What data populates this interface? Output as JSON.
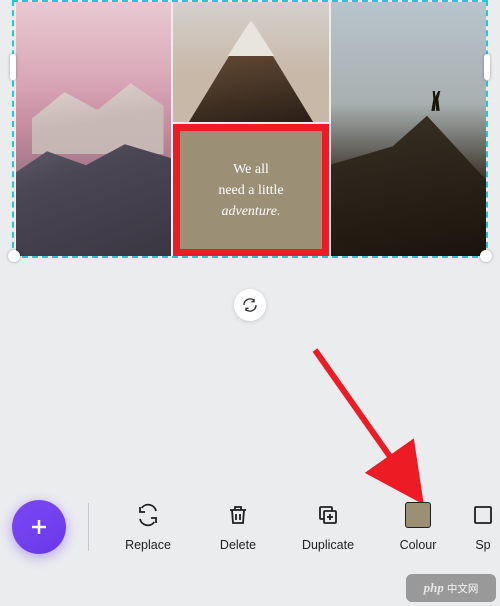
{
  "canvas": {
    "quote_line1": "We all",
    "quote_line2": "need a little",
    "quote_line3": "adventure.",
    "accent_color": "#9b9075",
    "highlight_color": "#ed1c24",
    "selection_color": "#22c8d6"
  },
  "toolbar": {
    "add_label": "+",
    "items": [
      {
        "id": "replace",
        "label": "Replace"
      },
      {
        "id": "delete",
        "label": "Delete"
      },
      {
        "id": "duplicate",
        "label": "Duplicate"
      },
      {
        "id": "colour",
        "label": "Colour"
      },
      {
        "id": "spacing",
        "label": "Sp"
      }
    ]
  },
  "watermark": {
    "brand": "php",
    "text": "中文网"
  }
}
